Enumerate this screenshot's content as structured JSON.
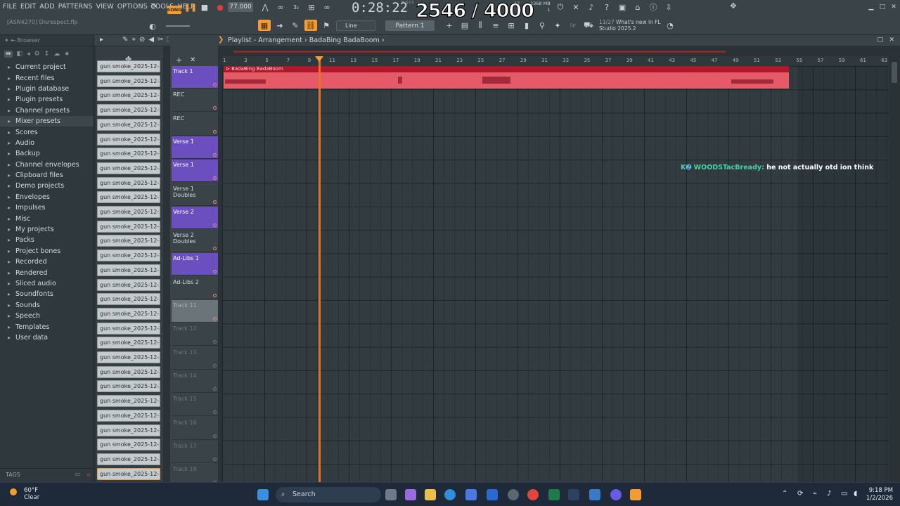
{
  "menu": [
    "FILE",
    "EDIT",
    "ADD",
    "PATTERNS",
    "VIEW",
    "OPTIONS",
    "TOOLS",
    "HELP"
  ],
  "project_name": "[ASN4270] Disrespect.flp",
  "transport": {
    "mode": "SONG",
    "tempo": "77.000",
    "time": "0:28:22",
    "time_small": "M:S:CS"
  },
  "overlay_counter": "2546 / 4000",
  "memory": {
    "mb": "2368 MB",
    "cpu": "12",
    "voices": "1"
  },
  "snap": "Line",
  "pattern": "Pattern 1",
  "news": {
    "counter": "11/27",
    "title": "What's new in FL",
    "subtitle": "Studio 2025.2"
  },
  "browser": {
    "title": "Browser",
    "items": [
      {
        "label": "Current project",
        "icon": "project-icon"
      },
      {
        "label": "Recent files",
        "icon": "recent-icon"
      },
      {
        "label": "Plugin database",
        "icon": "plugin-icon"
      },
      {
        "label": "Plugin presets",
        "icon": "preset-icon"
      },
      {
        "label": "Channel presets",
        "icon": "preset-icon"
      },
      {
        "label": "Mixer presets",
        "icon": "mixer-icon"
      },
      {
        "label": "Scores",
        "icon": "score-icon"
      },
      {
        "label": "Audio",
        "icon": "audio-icon"
      },
      {
        "label": "Backup",
        "icon": "folder-icon"
      },
      {
        "label": "Channel envelopes",
        "icon": "folder-icon"
      },
      {
        "label": "Clipboard files",
        "icon": "folder-icon"
      },
      {
        "label": "Demo projects",
        "icon": "folder-icon"
      },
      {
        "label": "Envelopes",
        "icon": "folder-icon"
      },
      {
        "label": "Impulses",
        "icon": "folder-icon"
      },
      {
        "label": "Misc",
        "icon": "folder-icon"
      },
      {
        "label": "My projects",
        "icon": "folder-icon"
      },
      {
        "label": "Packs",
        "icon": "folder-icon"
      },
      {
        "label": "Project bones",
        "icon": "folder-icon"
      },
      {
        "label": "Recorded",
        "icon": "record-icon"
      },
      {
        "label": "Rendered",
        "icon": "render-icon"
      },
      {
        "label": "Sliced audio",
        "icon": "folder-icon"
      },
      {
        "label": "Soundfonts",
        "icon": "folder-icon"
      },
      {
        "label": "Sounds",
        "icon": "folder-icon"
      },
      {
        "label": "Speech",
        "icon": "speech-icon"
      },
      {
        "label": "Templates",
        "icon": "folder-icon"
      },
      {
        "label": "User data",
        "icon": "user-icon"
      }
    ],
    "tags_label": "TAGS"
  },
  "channel_label": "gun smoke_2025-12-29...",
  "playlist": {
    "title": "Playlist - Arrangement",
    "arrangement": "BadaBing BadaBoom"
  },
  "tracks": [
    {
      "label": "Track 1",
      "style": "purple"
    },
    {
      "label": "REC",
      "style": "plain"
    },
    {
      "label": "REC",
      "style": "plain"
    },
    {
      "label": "Verse 1",
      "style": "purple"
    },
    {
      "label": "Verse 1",
      "style": "purple"
    },
    {
      "label": "Verse 1 Doubles",
      "style": "plain"
    },
    {
      "label": "Verse 2",
      "style": "purple"
    },
    {
      "label": "Verse 2 Doubles",
      "style": "plain"
    },
    {
      "label": "Ad-Libs 1",
      "style": "purple"
    },
    {
      "label": "Ad-Libs 2",
      "style": "plain"
    },
    {
      "label": "Track 11",
      "style": "gray"
    },
    {
      "label": "Track 12",
      "style": "dim"
    },
    {
      "label": "Track 13",
      "style": "dim"
    },
    {
      "label": "Track 14",
      "style": "dim"
    },
    {
      "label": "Track 15",
      "style": "dim"
    },
    {
      "label": "Track 16",
      "style": "dim"
    },
    {
      "label": "Track 17",
      "style": "dim"
    },
    {
      "label": "Track 18",
      "style": "dim"
    }
  ],
  "ruler": [
    "1",
    "3",
    "5",
    "7",
    "9",
    "11",
    "13",
    "15",
    "17",
    "19",
    "21",
    "23",
    "25",
    "27",
    "29",
    "31",
    "33",
    "35",
    "37",
    "39",
    "41",
    "43",
    "45",
    "47",
    "49",
    "51",
    "53",
    "55",
    "57",
    "59",
    "61",
    "63"
  ],
  "clip_label": "BadaBing BadaBoom",
  "chat": {
    "user": "WOODSTacBready:",
    "message": "he not actually otd ion think"
  },
  "taskbar": {
    "temp": "60°F",
    "weather": "Clear",
    "search": "Search",
    "time": "9:18 PM",
    "date": "1/2/2026"
  },
  "colors": {
    "accent": "#f39c34",
    "clip": "#e45a66",
    "track_purple": "#6b4fbf",
    "playhead": "#e8702f"
  }
}
